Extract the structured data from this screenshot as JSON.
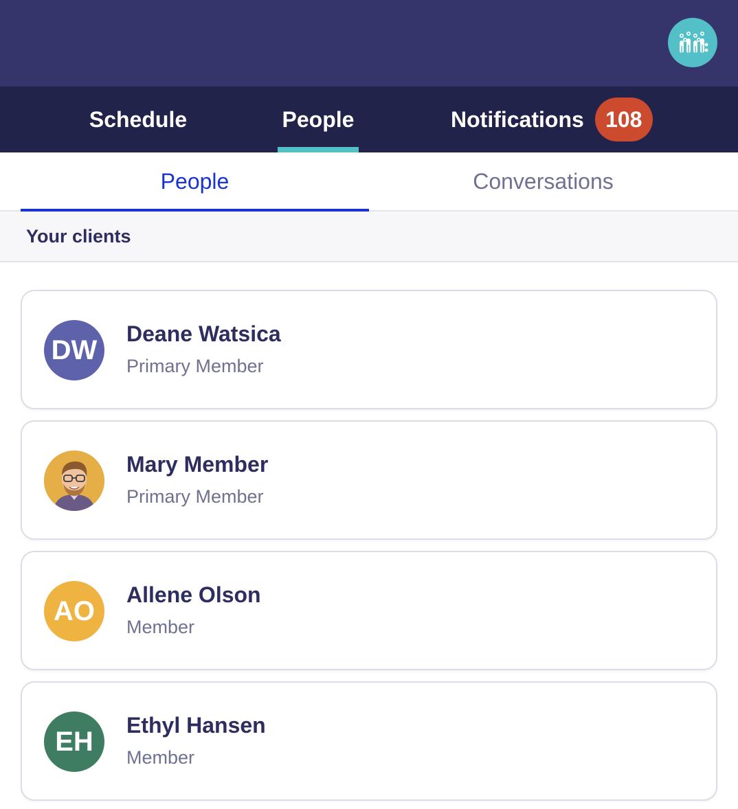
{
  "header": {
    "logo_icon": "people-group-icon",
    "logo_color": "#53bfc6",
    "background": "#35346b"
  },
  "nav": {
    "tabs": [
      {
        "label": "Schedule"
      },
      {
        "label": "People",
        "active": true
      },
      {
        "label": "Notifications",
        "badge": "108"
      }
    ],
    "accent": "#53bfc6",
    "badge_color": "#cc4a2e"
  },
  "subtabs": [
    {
      "label": "People",
      "active": true
    },
    {
      "label": "Conversations"
    }
  ],
  "section": {
    "title": "Your clients"
  },
  "clients": [
    {
      "initials": "DW",
      "name": "Deane Watsica",
      "role": "Primary Member",
      "avatar_color": "#5d62ab"
    },
    {
      "initials": "",
      "name": "Mary Member",
      "role": "Primary Member",
      "avatar_color": "#e5ae47",
      "avatar_type": "photo"
    },
    {
      "initials": "AO",
      "name": "Allene Olson",
      "role": "Member",
      "avatar_color": "#efb342"
    },
    {
      "initials": "EH",
      "name": "Ethyl Hansen",
      "role": "Member",
      "avatar_color": "#3e7d61"
    }
  ]
}
